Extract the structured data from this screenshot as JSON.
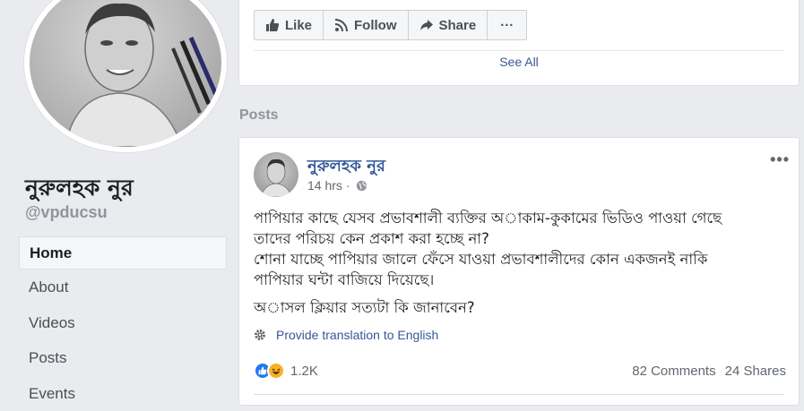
{
  "profile": {
    "name": "নুরুলহক নুর",
    "handle": "@vpducsu"
  },
  "nav": {
    "items": [
      {
        "label": "Home",
        "active": true
      },
      {
        "label": "About"
      },
      {
        "label": "Videos"
      },
      {
        "label": "Posts"
      },
      {
        "label": "Events"
      }
    ]
  },
  "page_actions": {
    "like": "Like",
    "follow": "Follow",
    "share": "Share",
    "more": "···",
    "see_all": "See All"
  },
  "posts_heading": "Posts",
  "post": {
    "author": "নুরুলহক নুর",
    "time": "14 hrs ·",
    "more": "•••",
    "lines": [
      "পাপিয়ার কাছে যেসব প্রভাবশালী ব্যক্তির অাকাম-কুকামের ভিডিও পাওয়া গেছে",
      "তাদের পরিচয় কেন প্রকাশ করা হচ্ছে না?",
      "শোনা যাচ্ছে পাপিয়ার জালে ফেঁসে যাওয়া প্রভাবশালীদের কোন একজনই নাকি",
      "পাপিয়ার ঘন্টা বাজিয়ে দিয়েছে।",
      "অাসল ক্লিয়ার সত্যটা কি জানাবেন?"
    ],
    "translate": "Provide translation to English",
    "reactions_count": "1.2K",
    "comments": "82 Comments",
    "shares": "24 Shares"
  },
  "colors": {
    "link": "#365899",
    "like_blue": "#2078f4",
    "haha_yellow": "#f7b125",
    "muted": "#90949c"
  },
  "icons": {
    "like": "thumbs-up-icon",
    "follow": "rss-icon",
    "share": "share-arrow-icon",
    "globe": "globe-icon",
    "translate": "gear-icon"
  }
}
